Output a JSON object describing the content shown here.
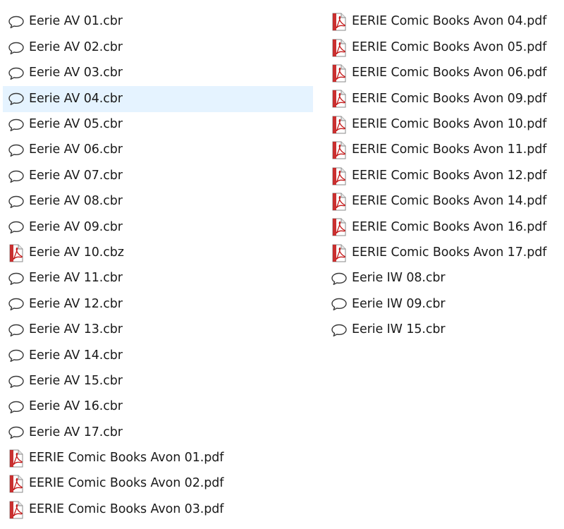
{
  "icons": {
    "chat": "speech-bubble-icon",
    "pdf": "pdf-document-icon"
  },
  "colors": {
    "selected_bg": "#e5f3ff",
    "pdf_red": "#c41a1a",
    "bubble_stroke": "#3a3a3a"
  },
  "left_files": [
    {
      "name": "Eerie AV 01.cbr",
      "icon": "chat",
      "selected": false
    },
    {
      "name": "Eerie AV 02.cbr",
      "icon": "chat",
      "selected": false
    },
    {
      "name": "Eerie AV 03.cbr",
      "icon": "chat",
      "selected": false
    },
    {
      "name": "Eerie AV 04.cbr",
      "icon": "chat",
      "selected": true
    },
    {
      "name": "Eerie AV 05.cbr",
      "icon": "chat",
      "selected": false
    },
    {
      "name": "Eerie AV 06.cbr",
      "icon": "chat",
      "selected": false
    },
    {
      "name": "Eerie AV 07.cbr",
      "icon": "chat",
      "selected": false
    },
    {
      "name": "Eerie AV 08.cbr",
      "icon": "chat",
      "selected": false
    },
    {
      "name": "Eerie AV 09.cbr",
      "icon": "chat",
      "selected": false
    },
    {
      "name": "Eerie AV 10.cbz",
      "icon": "pdf",
      "selected": false
    },
    {
      "name": "Eerie AV 11.cbr",
      "icon": "chat",
      "selected": false
    },
    {
      "name": "Eerie AV 12.cbr",
      "icon": "chat",
      "selected": false
    },
    {
      "name": "Eerie AV 13.cbr",
      "icon": "chat",
      "selected": false
    },
    {
      "name": "Eerie AV 14.cbr",
      "icon": "chat",
      "selected": false
    },
    {
      "name": "Eerie AV 15.cbr",
      "icon": "chat",
      "selected": false
    },
    {
      "name": "Eerie AV 16.cbr",
      "icon": "chat",
      "selected": false
    },
    {
      "name": "Eerie AV 17.cbr",
      "icon": "chat",
      "selected": false
    },
    {
      "name": "EERIE Comic Books Avon 01.pdf",
      "icon": "pdf",
      "selected": false
    },
    {
      "name": "EERIE Comic Books Avon 02.pdf",
      "icon": "pdf",
      "selected": false
    },
    {
      "name": "EERIE Comic Books Avon 03.pdf",
      "icon": "pdf",
      "selected": false
    }
  ],
  "right_files": [
    {
      "name": "EERIE Comic Books Avon 04.pdf",
      "icon": "pdf",
      "selected": false
    },
    {
      "name": "EERIE Comic Books Avon 05.pdf",
      "icon": "pdf",
      "selected": false
    },
    {
      "name": "EERIE Comic Books Avon 06.pdf",
      "icon": "pdf",
      "selected": false
    },
    {
      "name": "EERIE Comic Books Avon 09.pdf",
      "icon": "pdf",
      "selected": false
    },
    {
      "name": "EERIE Comic Books Avon 10.pdf",
      "icon": "pdf",
      "selected": false
    },
    {
      "name": "EERIE Comic Books Avon 11.pdf",
      "icon": "pdf",
      "selected": false
    },
    {
      "name": "EERIE Comic Books Avon 12.pdf",
      "icon": "pdf",
      "selected": false
    },
    {
      "name": "EERIE Comic Books Avon 14.pdf",
      "icon": "pdf",
      "selected": false
    },
    {
      "name": "EERIE Comic Books Avon 16.pdf",
      "icon": "pdf",
      "selected": false
    },
    {
      "name": "EERIE Comic Books Avon 17.pdf",
      "icon": "pdf",
      "selected": false
    },
    {
      "name": "Eerie IW 08.cbr",
      "icon": "chat",
      "selected": false
    },
    {
      "name": "Eerie IW 09.cbr",
      "icon": "chat",
      "selected": false
    },
    {
      "name": "Eerie IW 15.cbr",
      "icon": "chat",
      "selected": false
    }
  ]
}
